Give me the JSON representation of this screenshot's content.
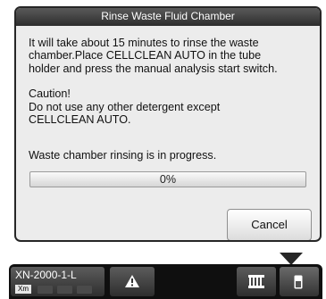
{
  "dialog": {
    "title": "Rinse Waste Fluid Chamber",
    "message": "It will take about 15 minutes to rinse the waste\nchamber.Place CELLCLEAN AUTO in the tube\nholder and press the manual analysis start switch.",
    "caution_heading": "Caution!",
    "caution_text": "Do not use any other detergent except\nCELLCLEAN AUTO.",
    "status_text": "Waste chamber rinsing is in progress.",
    "progress": {
      "percent_label": "0%",
      "value_percent": 0
    },
    "cancel_label": "Cancel"
  },
  "taskbar": {
    "machine_name": "XN-2000-1-L",
    "mode_label": "Xm",
    "icons": [
      "alarm-warning-icon",
      "rack-icon",
      "tube-icon"
    ]
  },
  "colors": {
    "title_bar": "#3b3b3b",
    "dialog_bg": "#ececec",
    "taskbar_bg": "#0f0f0f"
  }
}
